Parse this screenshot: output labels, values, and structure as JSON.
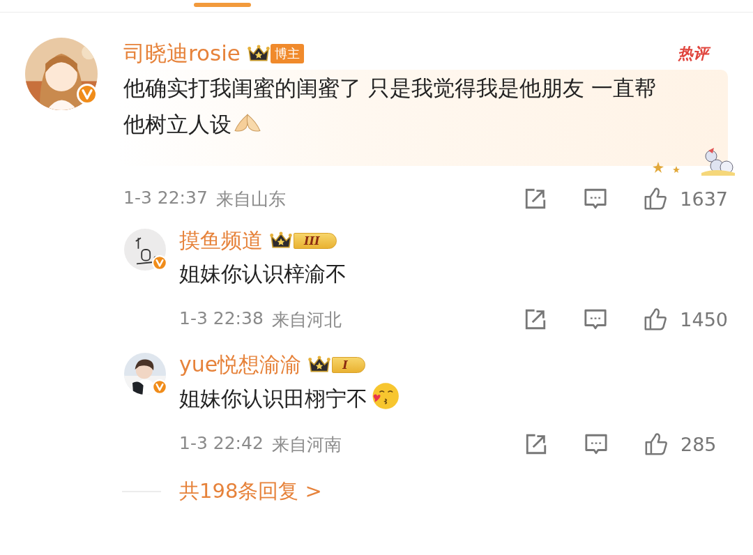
{
  "comment": {
    "user": "司晓迪rosie",
    "badge": {
      "kind": "role",
      "label": "博主"
    },
    "hot_label": "热评",
    "text": "他确实打我闺蜜的闺蜜了 只是我觉得我是他朋友 一直帮他树立人设",
    "emoji": {
      "kind": "hands"
    },
    "time": "1-3 22:37",
    "location": "来自山东",
    "likes": "1637"
  },
  "replies": [
    {
      "user": "摸鱼频道",
      "badge": {
        "kind": "level",
        "label": "III"
      },
      "text": "姐妹你认识梓渝不",
      "time": "1-3 22:38",
      "location": "来自河北",
      "likes": "1450"
    },
    {
      "user": "yue悦想渝渝",
      "badge": {
        "kind": "level",
        "label": "I"
      },
      "text": "姐妹你认识田栩宁不",
      "emoji": {
        "kind": "kiss"
      },
      "time": "1-3 22:42",
      "location": "来自河南",
      "likes": "285"
    }
  ],
  "more_replies": "共198条回复 >"
}
